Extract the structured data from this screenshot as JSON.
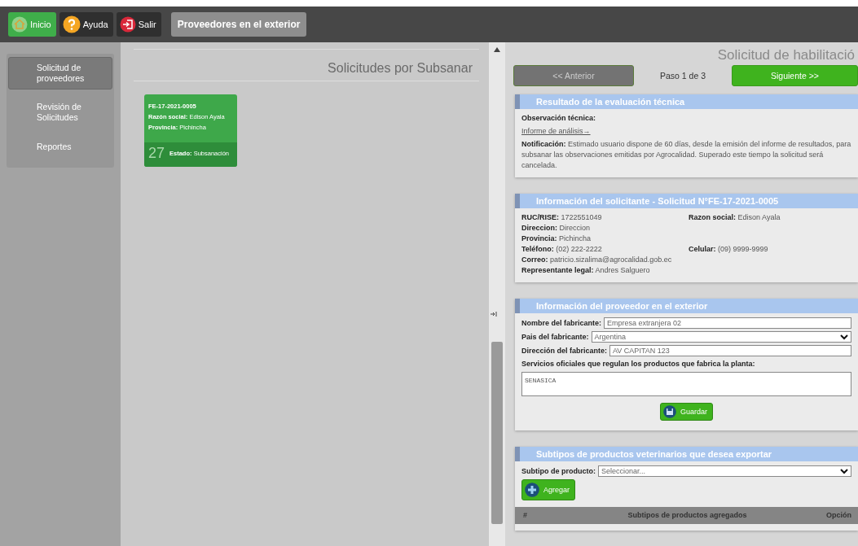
{
  "toolbar": {
    "buttons": [
      {
        "label": "Inicio",
        "kind": "home",
        "selected": true
      },
      {
        "label": "Ayuda",
        "kind": "help",
        "selected": false
      },
      {
        "label": "Salir",
        "kind": "exit",
        "selected": false
      }
    ],
    "title": "Proveedores en el exterior"
  },
  "sidebar": {
    "items": [
      {
        "label": "Solicitud de proveedores",
        "selected": true
      },
      {
        "label": "Revisión de Solicitudes",
        "selected": false
      },
      {
        "label": "Reportes",
        "selected": false
      }
    ]
  },
  "list_panel": {
    "title": "Solicitudes por Subsanar",
    "cards": [
      {
        "code": "FE-17-2021-0005",
        "lines": [
          "**Razón social:** Edison Ayala",
          "**Provincia:** Pichincha"
        ],
        "count": "27",
        "status": "**Estado:** Subsanación"
      }
    ]
  },
  "detail": {
    "title": "Solicitud de habilitació",
    "nav": {
      "previous": "<< Anterior",
      "step": "Paso 1 de 3",
      "next": "Siguiente >>"
    },
    "sections": [
      {
        "kind": "evaluation",
        "title": "Resultado de la evaluación técnica",
        "observation": "Observación técnica:",
        "link": "Informe de análisis→",
        "notification": "**Notificación:** Estimado usuario dispone de 60 días, desde la emisión del informe de resultados, para subsanar las observaciones emitidas por Agrocalidad. Superado este tiempo la solicitud será cancelada."
      },
      {
        "kind": "applicant",
        "title": "Información del solicitante - Solicitud N°FE-17-2021-0005",
        "rows": [
          [
            "**RUC/RISE:** 1722551049",
            "**Razon social:** Edison Ayala"
          ],
          [
            "**Direccion:** Direccion"
          ],
          [
            "**Provincia:** Pichincha"
          ],
          [
            "**Teléfono:** (02) 222-2222",
            "**Celular:** (09) 9999-9999"
          ],
          [
            "**Correo:** patricio.sizalima@agrocalidad.gob.ec"
          ],
          [
            "**Representante legal:** Andres Salguero"
          ]
        ]
      },
      {
        "kind": "provider",
        "title": "Información del proveedor en el exterior",
        "fields": [
          {
            "kind": "text",
            "label": "Nombre del fabricante:",
            "value": "Empresa extranjera 02"
          },
          {
            "kind": "select",
            "label": "Pais del fabricante:",
            "value": "Argentina"
          },
          {
            "kind": "text",
            "label": "Dirección del fabricante:",
            "value": "AV CAPITAN 123"
          }
        ],
        "textarea": {
          "label": "Servicios oficiales que regulan los productos que fabrica la planta:",
          "value": "SENASICA"
        },
        "button": "Guardar"
      },
      {
        "kind": "subtypes",
        "title": "Subtipos de productos veterinarios que desea exportar",
        "select": {
          "label": "Subtipo de producto:",
          "value": "Seleccionar..."
        },
        "button": "Agregar",
        "columns": [
          "#",
          "Subtipos de productos agregados",
          "Opción"
        ]
      }
    ]
  }
}
